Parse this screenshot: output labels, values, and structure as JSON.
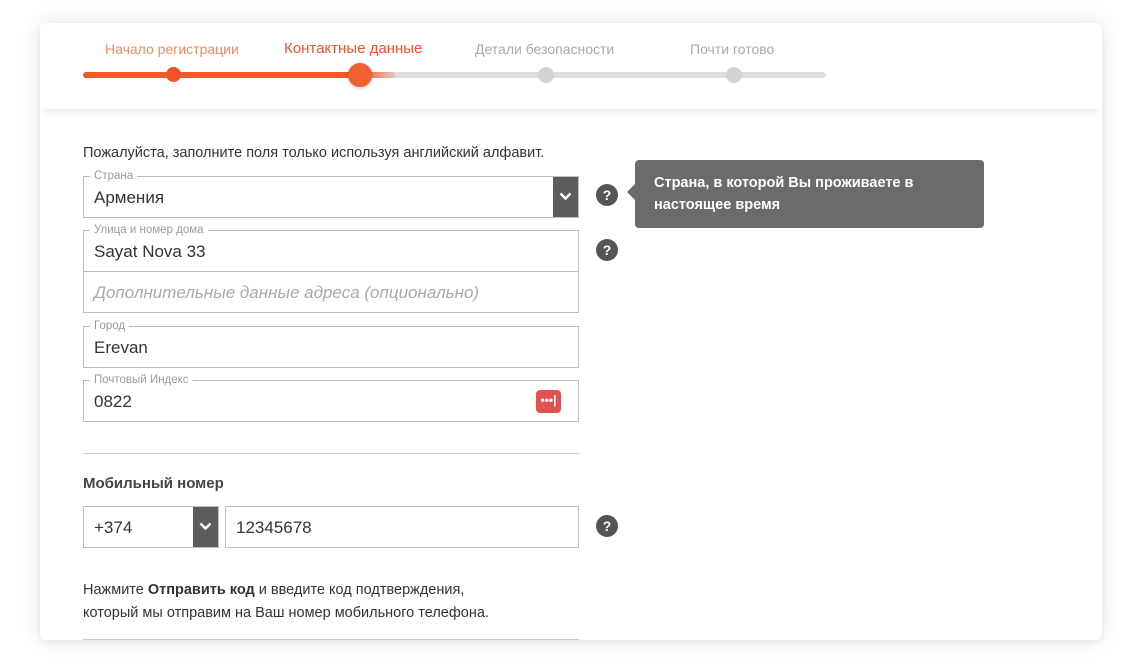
{
  "stepper": {
    "steps": [
      {
        "label": "Начало регистрации",
        "state": "completed"
      },
      {
        "label": "Контактные данные",
        "state": "current"
      },
      {
        "label": "Детали безопасности",
        "state": "upcoming"
      },
      {
        "label": "Почти готово",
        "state": "upcoming"
      }
    ],
    "progress_fraction": 0.42
  },
  "instruction": "Пожалуйста, заполните поля только используя английский алфавит.",
  "country": {
    "legend": "Страна",
    "value": "Армения"
  },
  "tooltip": {
    "line1": "Страна, в которой Вы проживаете в",
    "line2": "настоящее время"
  },
  "street": {
    "legend": "Улица и номер дома",
    "value": "Sayat Nova 33"
  },
  "address2": {
    "placeholder": "Дополнительные данные адреса (опционально)"
  },
  "city": {
    "legend": "Город",
    "value": "Erevan"
  },
  "postcode": {
    "legend": "Почтовый Индекс",
    "value": "0822",
    "badge": "•••|"
  },
  "mobile": {
    "title": "Мобильный номер",
    "country_code": "+374",
    "number": "12345678"
  },
  "note": {
    "prefix": "Нажмите ",
    "bold": "Отправить код",
    "suffix": " и введите код подтверждения,",
    "line2": "который мы отправим на Ваш номер мобильного телефона."
  },
  "help_icon_glyph": "?",
  "colors": {
    "accent": "#f0532a",
    "completed_step": "#f08a5d",
    "upcoming_step": "#a8a8a8",
    "tooltip_bg": "#6b6b6b",
    "select_button": "#5d5d5d",
    "password_badge": "#e05250"
  }
}
